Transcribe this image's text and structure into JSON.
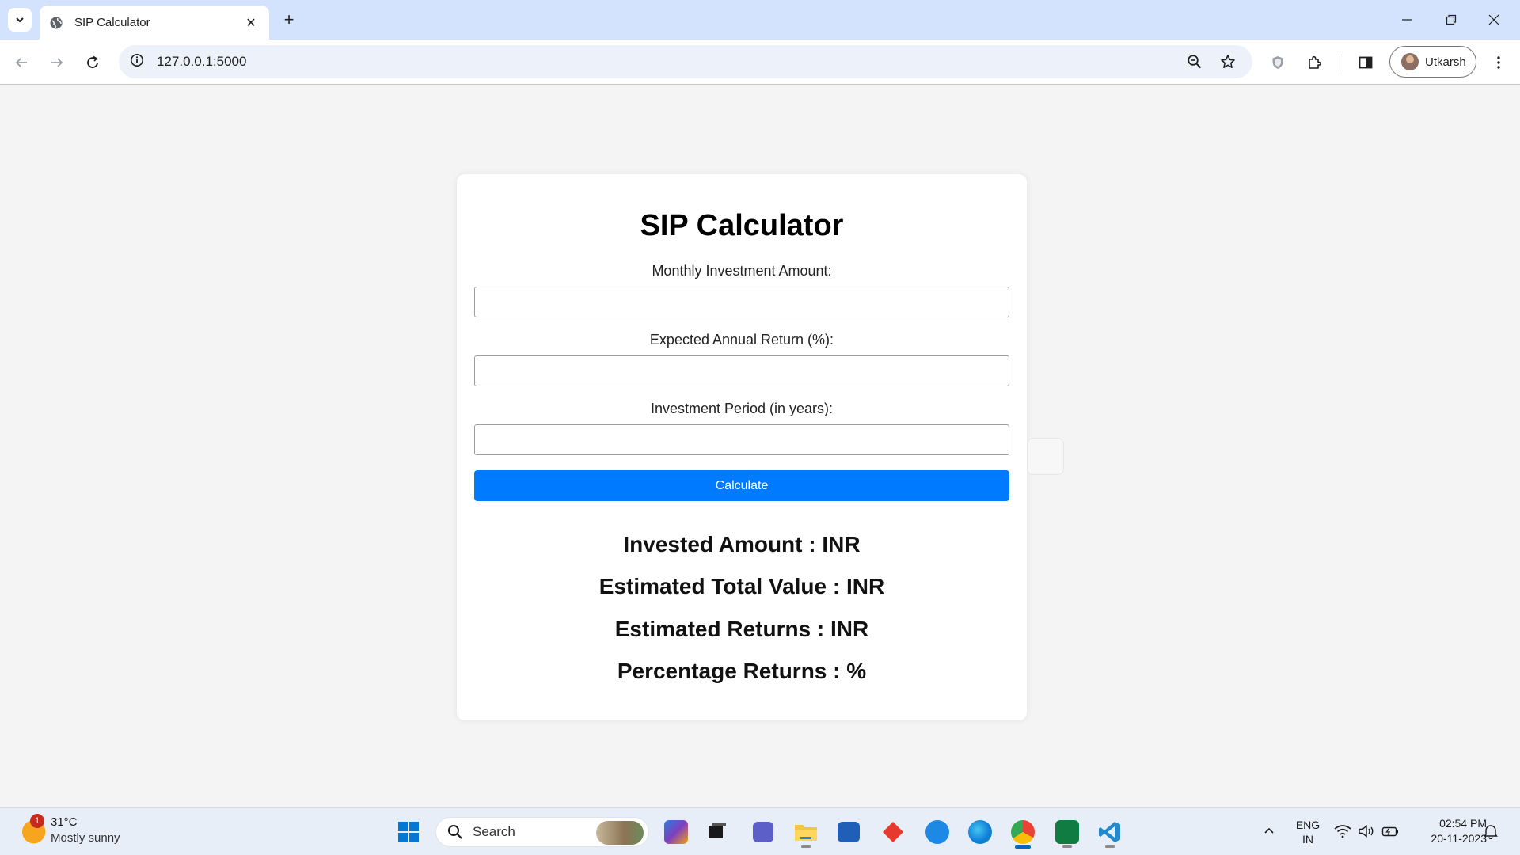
{
  "browser": {
    "tab_title": "SIP Calculator",
    "tab_close_glyph": "✕",
    "new_tab_glyph": "+",
    "url": "127.0.0.1:5000",
    "profile_name": "Utkarsh"
  },
  "form": {
    "title": "SIP Calculator",
    "fields": [
      {
        "label": "Monthly Investment Amount:",
        "value": ""
      },
      {
        "label": "Expected Annual Return (%):",
        "value": ""
      },
      {
        "label": "Investment Period (in years):",
        "value": ""
      }
    ],
    "button_label": "Calculate"
  },
  "results": {
    "invested": "Invested Amount : INR",
    "total_value": "Estimated Total Value : INR",
    "returns": "Estimated Returns : INR",
    "percentage": "Percentage Returns : %"
  },
  "taskbar": {
    "weather_badge": "1",
    "weather_temp": "31°C",
    "weather_desc": "Mostly sunny",
    "search_label": "Search",
    "lang_line1": "ENG",
    "lang_line2": "IN",
    "time": "02:54 PM",
    "date": "20-11-2023"
  },
  "colors": {
    "accent": "#007bff",
    "tabstrip": "#d3e3fd",
    "page_bg": "#f4f4f4"
  },
  "icons": {
    "tab_menu": "chevron-down-icon",
    "favicon": "globe-icon",
    "back": "arrow-left-icon",
    "forward": "arrow-right-icon",
    "reload": "reload-icon",
    "site_info": "info-icon",
    "zoom": "zoom-icon",
    "bookmark": "star-icon",
    "extension_shield": "shield-icon",
    "extensions": "puzzle-icon",
    "side_panel": "side-panel-icon",
    "menu": "kebab-menu-icon"
  }
}
